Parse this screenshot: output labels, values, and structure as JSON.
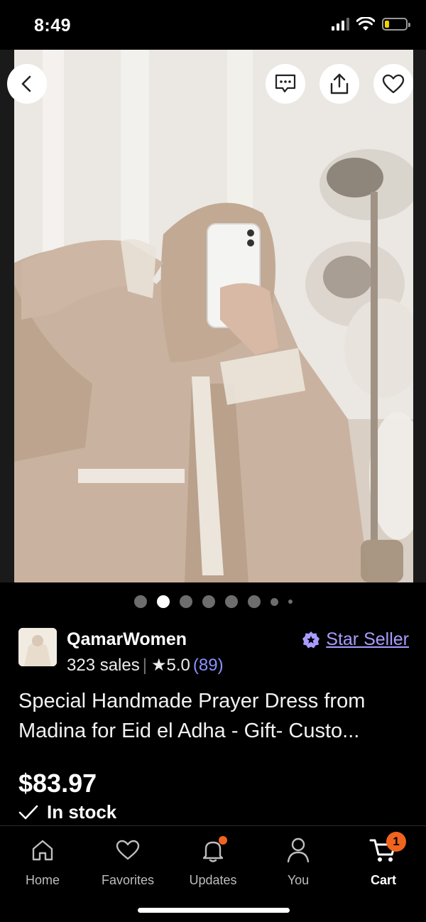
{
  "status_bar": {
    "time": "8:49",
    "battery_level": 0.2
  },
  "hero": {
    "icons": [
      "back-icon",
      "message-icon",
      "share-icon",
      "heart-icon"
    ],
    "carousel": {
      "count": 8,
      "active_index": 1
    }
  },
  "shop": {
    "name": "QamarWomen",
    "sales": "323 sales",
    "separator": "|",
    "rating": "5.0",
    "rating_count": "(89)",
    "badge_label": "Star Seller"
  },
  "listing": {
    "title": "Special Handmade Prayer Dress from Madina for Eid el Adha - Gift- Custo...",
    "price": "$83.97",
    "stock_status": "In stock"
  },
  "tab_bar": {
    "tabs": [
      {
        "label": "Home",
        "icon": "home-icon"
      },
      {
        "label": "Favorites",
        "icon": "heart-icon"
      },
      {
        "label": "Updates",
        "icon": "bell-icon"
      },
      {
        "label": "You",
        "icon": "person-icon"
      },
      {
        "label": "Cart",
        "icon": "cart-icon"
      }
    ],
    "active": "Cart",
    "cart_count": "1"
  },
  "colors": {
    "accent": "#f1641e",
    "star_seller": "#a79cff",
    "rating_count": "#8a93ff"
  }
}
